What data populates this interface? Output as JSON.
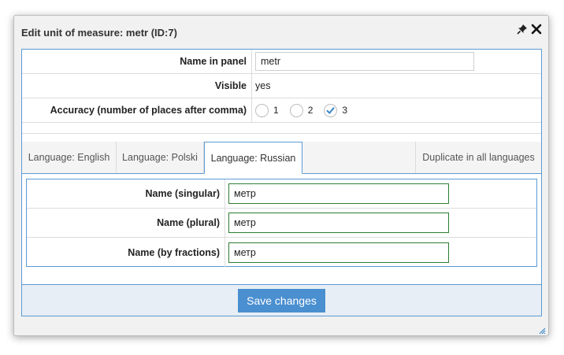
{
  "dialog": {
    "title": "Edit unit of measure: metr (ID:7)",
    "icons": [
      "pin-icon",
      "close-icon"
    ]
  },
  "properties": {
    "name_in_panel": {
      "label": "Name in panel",
      "value": "metr"
    },
    "visible": {
      "label": "Visible",
      "value": "yes"
    },
    "accuracy": {
      "label": "Accuracy (number of places after comma)",
      "options": [
        "1",
        "2",
        "3"
      ],
      "selected": "3"
    }
  },
  "tabs": [
    {
      "label": "Language: English",
      "active": false
    },
    {
      "label": "Language: Polski",
      "active": false
    },
    {
      "label": "Language: Russian",
      "active": true
    }
  ],
  "duplicate_tab": "Duplicate in all languages",
  "language_fields": {
    "singular": {
      "label": "Name (singular)",
      "value": "метр"
    },
    "plural": {
      "label": "Name (plural)",
      "value": "метр"
    },
    "fractions": {
      "label": "Name (by fractions)",
      "value": "метр"
    }
  },
  "footer": {
    "save_label": "Save changes"
  },
  "colors": {
    "accent": "#4a8fd0",
    "panel_border": "#5b9bd5",
    "input_valid_border": "#2e7d32"
  }
}
